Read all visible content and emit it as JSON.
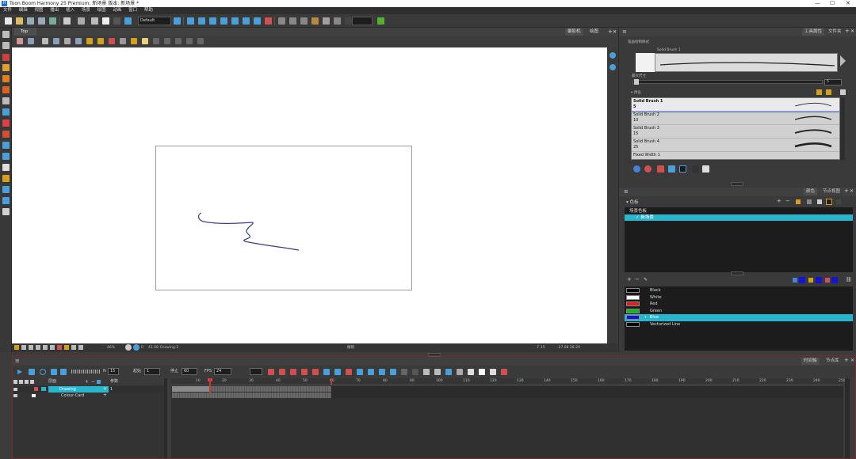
{
  "window": {
    "title": "Toon Boom Harmony 25 Premium: 新场景 版本: 新场景 *",
    "app_icon": "H"
  },
  "menu": [
    "文件",
    "编辑",
    "视图",
    "播出",
    "插入",
    "场景",
    "绘图",
    "动画",
    "窗口",
    "帮助"
  ],
  "toolbar": {
    "preset": "Default"
  },
  "view": {
    "tab": "Top",
    "tabs_right": [
      "摄影机",
      "绘图"
    ],
    "status": {
      "zoom": "46%",
      "view_angle": "0",
      "fov": "41.08",
      "drawing": "Drawing-2",
      "mode": "撤销",
      "frame": "F 15",
      "coords": "-27.08 28.29"
    }
  },
  "tool_properties": {
    "tabs": [
      "工具属性",
      "文件夹"
    ],
    "preview_label": "笔画绘制样式",
    "brush_label": "Solid Brush 1",
    "size_label": "最大尺寸",
    "size_value": "5",
    "presets_label": "预设",
    "brushes": [
      {
        "name": "Solid Brush 1",
        "size": "5"
      },
      {
        "name": "Solid Brush 2",
        "size": "10"
      },
      {
        "name": "Solid Brush 3",
        "size": "15"
      },
      {
        "name": "Solid Brush 4",
        "size": "25"
      },
      {
        "name": "Fixed Width 1",
        "size": ""
      }
    ]
  },
  "colour": {
    "tabs": [
      "颜色",
      "节点视图"
    ],
    "palette_header": "色板",
    "palettes": [
      "场景色板",
      "新场景"
    ],
    "swatches": [
      {
        "name": "Black",
        "color": "#000000"
      },
      {
        "name": "White",
        "color": "#ffffff"
      },
      {
        "name": "Red",
        "color": "#e01c1c"
      },
      {
        "name": "Green",
        "color": "#19b419"
      },
      {
        "name": "Blue",
        "color": "#1414d2"
      },
      {
        "name": "Vectorized Line",
        "color": "#000000"
      }
    ]
  },
  "timeline": {
    "tabs": [
      "时间轴",
      "节点库"
    ],
    "current_frame": "15",
    "start_label": "起始",
    "start": "1",
    "stop_label": "停止",
    "stop": "60",
    "fps_label": "FPS",
    "fps": "24",
    "layers_label": "层面",
    "params_label": "参数",
    "layers": [
      {
        "name": "Drawing",
        "value": "1"
      },
      {
        "name": "Colour-Card",
        "value": ""
      }
    ],
    "ruler": [
      "10",
      "20",
      "30",
      "40",
      "50",
      "60",
      "70",
      "80",
      "90",
      "100",
      "110",
      "120",
      "130",
      "140",
      "150",
      "160",
      "170",
      "180",
      "190",
      "200",
      "210",
      "220",
      "230",
      "240",
      "250"
    ]
  },
  "accent": "#29b5cc"
}
